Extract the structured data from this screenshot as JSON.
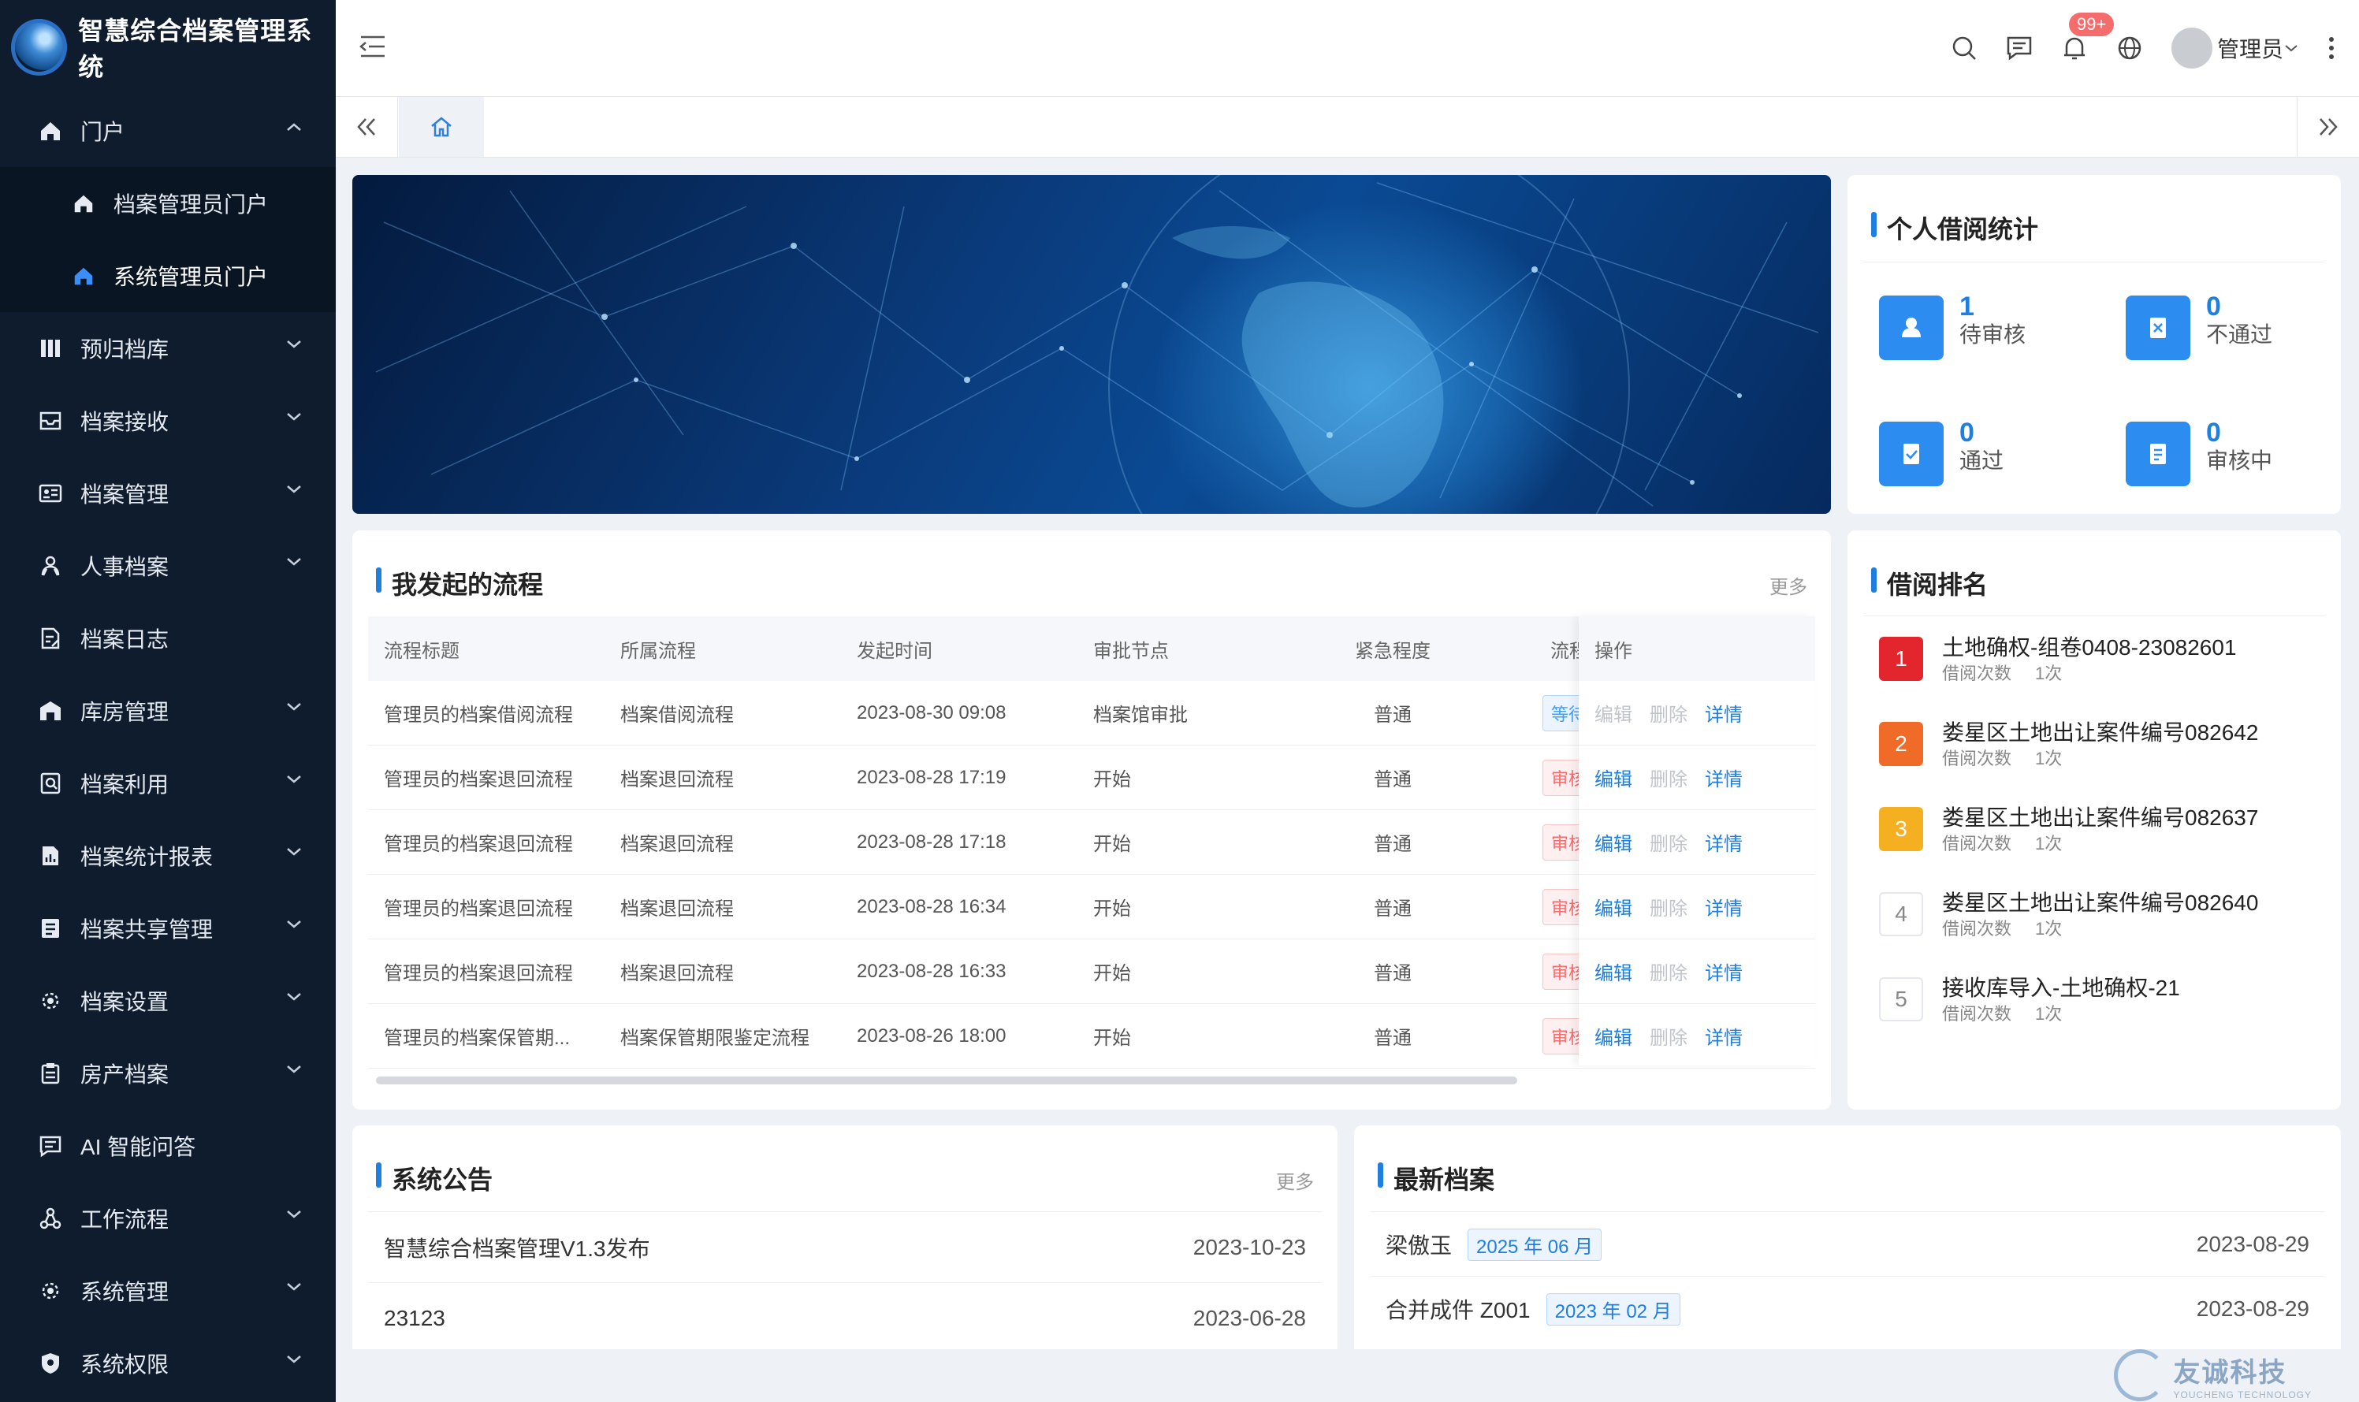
{
  "app": {
    "title": "智慧综合档案管理系统"
  },
  "sidebar": {
    "items": [
      {
        "label": "门户",
        "icon": "home-icon",
        "expanded": true,
        "children": [
          {
            "label": "档案管理员门户",
            "icon": "home-icon"
          },
          {
            "label": "系统管理员门户",
            "icon": "home-icon",
            "active": true
          }
        ]
      },
      {
        "label": "预归档库",
        "icon": "columns-icon"
      },
      {
        "label": "档案接收",
        "icon": "inbox-icon"
      },
      {
        "label": "档案管理",
        "icon": "id-card-icon"
      },
      {
        "label": "人事档案",
        "icon": "users-icon"
      },
      {
        "label": "档案日志",
        "icon": "edit-doc-icon"
      },
      {
        "label": "库房管理",
        "icon": "warehouse-icon"
      },
      {
        "label": "档案利用",
        "icon": "search-doc-icon"
      },
      {
        "label": "档案统计报表",
        "icon": "report-icon"
      },
      {
        "label": "档案共享管理",
        "icon": "share-doc-icon"
      },
      {
        "label": "档案设置",
        "icon": "gear-icon"
      },
      {
        "label": "房产档案",
        "icon": "clipboard-icon"
      },
      {
        "label": "AI 智能问答",
        "icon": "message-icon"
      },
      {
        "label": "工作流程",
        "icon": "flow-icon"
      },
      {
        "label": "系统管理",
        "icon": "gear-icon"
      },
      {
        "label": "系统权限",
        "icon": "shield-icon"
      }
    ]
  },
  "header": {
    "notification_count": "99+",
    "user": "管理员"
  },
  "stats": {
    "title": "个人借阅统计",
    "items": [
      {
        "num": "1",
        "label": "待审核",
        "icon": "user-icon"
      },
      {
        "num": "0",
        "label": "不通过",
        "icon": "reject-doc-icon"
      },
      {
        "num": "0",
        "label": "通过",
        "icon": "check-doc-icon"
      },
      {
        "num": "0",
        "label": "审核中",
        "icon": "pending-doc-icon"
      }
    ]
  },
  "processes": {
    "title": "我发起的流程",
    "more": "更多",
    "columns": [
      "流程标题",
      "所属流程",
      "发起时间",
      "审批节点",
      "紧急程度",
      "流程",
      "操作"
    ],
    "rows": [
      {
        "title": "管理员的档案借阅流程",
        "flow": "档案借阅流程",
        "time": "2023-08-30 09:08",
        "node": "档案馆审批",
        "urgency": "普通",
        "status": "等待",
        "status_type": "wait",
        "edit_enabled": false
      },
      {
        "title": "管理员的档案退回流程",
        "flow": "档案退回流程",
        "time": "2023-08-28 17:19",
        "node": "开始",
        "urgency": "普通",
        "status": "审核",
        "status_type": "reject",
        "edit_enabled": true
      },
      {
        "title": "管理员的档案退回流程",
        "flow": "档案退回流程",
        "time": "2023-08-28 17:18",
        "node": "开始",
        "urgency": "普通",
        "status": "审核",
        "status_type": "reject",
        "edit_enabled": true
      },
      {
        "title": "管理员的档案退回流程",
        "flow": "档案退回流程",
        "time": "2023-08-28 16:34",
        "node": "开始",
        "urgency": "普通",
        "status": "审核",
        "status_type": "reject",
        "edit_enabled": true
      },
      {
        "title": "管理员的档案退回流程",
        "flow": "档案退回流程",
        "time": "2023-08-28 16:33",
        "node": "开始",
        "urgency": "普通",
        "status": "审核",
        "status_type": "reject",
        "edit_enabled": true
      },
      {
        "title": "管理员的档案保管期...",
        "flow": "档案保管期限鉴定流程",
        "time": "2023-08-26 18:00",
        "node": "开始",
        "urgency": "普通",
        "status": "审核",
        "status_type": "reject",
        "edit_enabled": true
      }
    ],
    "actions": {
      "edit": "编辑",
      "delete": "删除",
      "detail": "详情"
    }
  },
  "ranking": {
    "title": "借阅排名",
    "count_label": "借阅次数",
    "items": [
      {
        "rank": "1",
        "title": "土地确权-组卷0408-23082601",
        "count": "1次",
        "color": "#e3262e"
      },
      {
        "rank": "2",
        "title": "娄星区土地出让案件编号082642",
        "count": "1次",
        "color": "#f06a28"
      },
      {
        "rank": "3",
        "title": "娄星区土地出让案件编号082637",
        "count": "1次",
        "color": "#f5b022"
      },
      {
        "rank": "4",
        "title": "娄星区土地出让案件编号082640",
        "count": "1次",
        "color": ""
      },
      {
        "rank": "5",
        "title": "接收库导入-土地确权-21",
        "count": "1次",
        "color": ""
      }
    ]
  },
  "notices": {
    "title": "系统公告",
    "more": "更多",
    "items": [
      {
        "title": "智慧综合档案管理V1.3发布",
        "date": "2023-10-23"
      },
      {
        "title": "23123",
        "date": "2023-06-28"
      }
    ]
  },
  "latest": {
    "title": "最新档案",
    "items": [
      {
        "title": "梁傲玉",
        "tag": "2025 年 06 月",
        "date": "2023-08-29"
      },
      {
        "title": "合并成件 Z001",
        "tag": "2023 年 02 月",
        "date": "2023-08-29"
      }
    ]
  },
  "watermark": {
    "cn": "友诚科技",
    "en": "YOUCHENG TECHNOLOGY"
  }
}
